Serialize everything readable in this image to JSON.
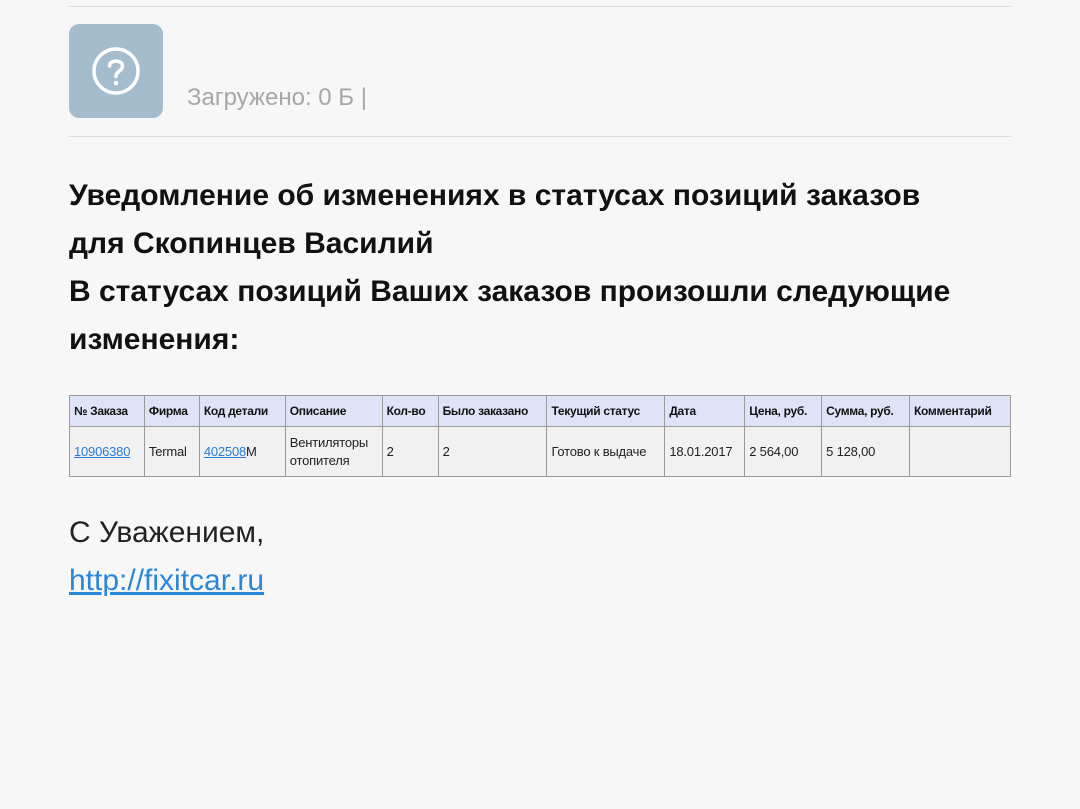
{
  "attachment": {
    "icon": "help-circle-icon",
    "tile_color": "#a4bccb",
    "loaded_text": "Загружено: 0 Б |"
  },
  "message": {
    "heading_lines": [
      "Уведомление об изменениях в статусах позиций заказов",
      "для Скопинцев Василий",
      "В статусах позиций Ваших заказов произошли следующие",
      "изменения:"
    ]
  },
  "table": {
    "headers": {
      "order_no": "№ Заказа",
      "firm": "Фирма",
      "part_code": "Код детали",
      "description": "Описание",
      "qty": "Кол-во",
      "ordered": "Было заказано",
      "status": "Текущий статус",
      "date": "Дата",
      "price": "Цена, руб.",
      "sum": "Сумма, руб.",
      "comment": "Комментарий"
    },
    "row": {
      "order_no": "10906380",
      "firm": "Termal",
      "part_code_link": "402508",
      "part_code_suffix": "M",
      "description": "Вентиляторы отопителя",
      "qty": "2",
      "ordered": "2",
      "status": "Готово к выдаче",
      "date": "18.01.2017",
      "price": "2 564,00",
      "sum": "5 128,00",
      "comment": ""
    },
    "header_bg": "#dee3f8",
    "link_color": "#2a7bd8"
  },
  "footer": {
    "regards": "С Уважением,",
    "site_link": "http://fixitcar.ru"
  }
}
